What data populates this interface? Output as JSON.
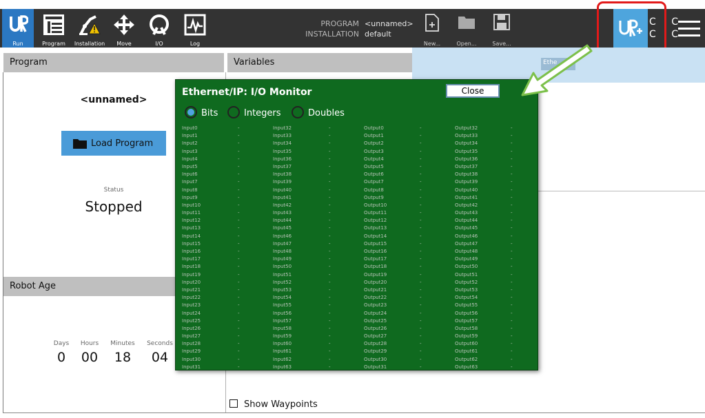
{
  "topbar": {
    "nav": [
      {
        "label": "Run"
      },
      {
        "label": "Program"
      },
      {
        "label": "Installation"
      },
      {
        "label": "Move"
      },
      {
        "label": "I/O"
      },
      {
        "label": "Log"
      }
    ],
    "program_label": "PROGRAM",
    "installation_label": "INSTALLATION",
    "program_value": "<unnamed>",
    "installation_value": "default",
    "file_buttons": [
      {
        "label": "New..."
      },
      {
        "label": "Open..."
      },
      {
        "label": "Save..."
      }
    ],
    "cc_text_1": "C C",
    "cc_text_2": "C C"
  },
  "program_panel": {
    "title": "Program",
    "program_name": "<unnamed>",
    "load_button": "Load Program",
    "status_label": "Status",
    "status_value": "Stopped"
  },
  "variables_panel": {
    "title": "Variables",
    "tab_text": "Ethe"
  },
  "robot_age": {
    "title": "Robot Age",
    "units": [
      {
        "label": "Days",
        "value": "0"
      },
      {
        "label": "Hours",
        "value": "00"
      },
      {
        "label": "Minutes",
        "value": "18"
      },
      {
        "label": "Seconds",
        "value": "04"
      }
    ]
  },
  "show_waypoints": "Show Waypoints",
  "dialog": {
    "title": "Ethernet/IP: I/O Monitor",
    "close_button": "Close",
    "radios": [
      {
        "label": "Bits",
        "selected": true
      },
      {
        "label": "Integers",
        "selected": false
      },
      {
        "label": "Doubles",
        "selected": false
      }
    ],
    "columns": [
      {
        "prefix": "Input",
        "start": 0,
        "count": 32,
        "value": "-"
      },
      {
        "prefix": "Input",
        "start": 32,
        "count": 32,
        "value": "-"
      },
      {
        "prefix": "Output",
        "start": 0,
        "count": 32,
        "value": "-"
      },
      {
        "prefix": "Output",
        "start": 32,
        "count": 32,
        "value": "-"
      }
    ]
  },
  "colors": {
    "topbar": "#333333",
    "run_active": "#2b78c2",
    "dialog_bg": "#0f6a1f",
    "highlight": "#e21a1a",
    "arrow": "#7cc04a"
  }
}
